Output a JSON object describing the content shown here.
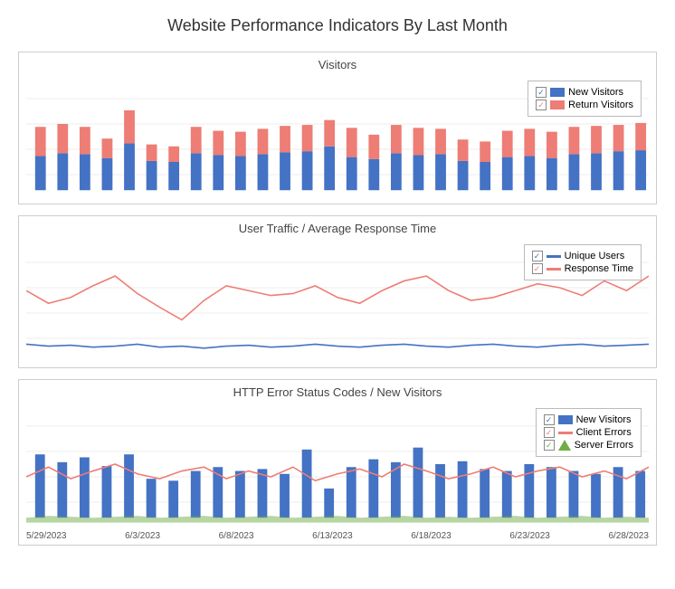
{
  "title": "Website Performance Indicators By Last Month",
  "charts": [
    {
      "id": "visitors",
      "title": "Visitors",
      "legend": [
        {
          "label": "New Visitors",
          "type": "bar",
          "color": "#4472C4"
        },
        {
          "label": "Return Visitors",
          "type": "bar",
          "color": "#ED7D75"
        }
      ]
    },
    {
      "id": "traffic",
      "title": "User Traffic / Average Response Time",
      "legend": [
        {
          "label": "Unique Users",
          "type": "line",
          "color": "#4472C4"
        },
        {
          "label": "Response Time",
          "type": "line",
          "color": "#ED7D75"
        }
      ]
    },
    {
      "id": "errors",
      "title": "HTTP Error Status Codes / New Visitors",
      "legend": [
        {
          "label": "New Visitors",
          "type": "bar",
          "color": "#4472C4"
        },
        {
          "label": "Client Errors",
          "type": "line",
          "color": "#ED7D75"
        },
        {
          "label": "Server Errors",
          "type": "area",
          "color": "#70AD47"
        }
      ]
    }
  ],
  "xLabels": [
    "5/29/2023",
    "6/3/2023",
    "6/8/2023",
    "6/13/2023",
    "6/18/2023",
    "6/23/2023",
    "6/28/2023"
  ]
}
